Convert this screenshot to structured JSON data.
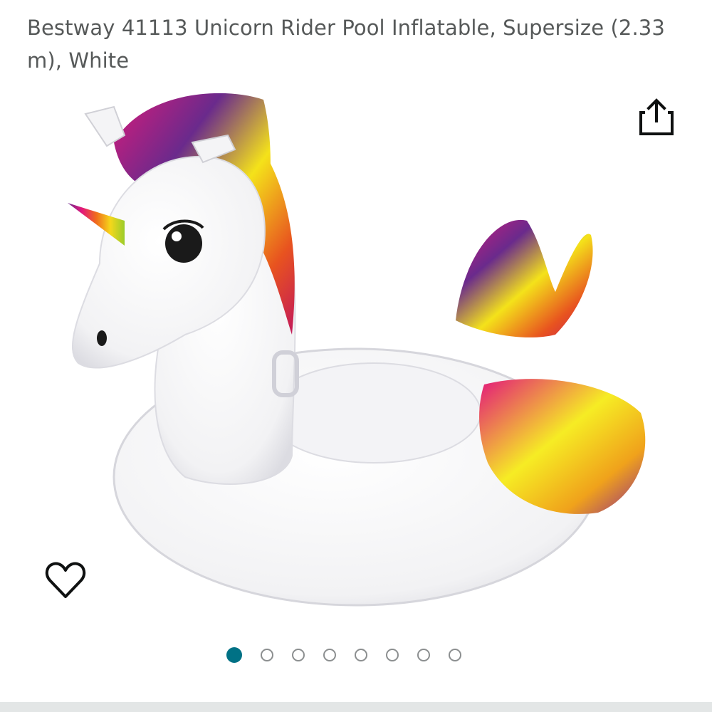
{
  "product": {
    "title": "Bestway 41113 Unicorn Rider Pool Inflatable, Supersize (2.33 m), White"
  },
  "actions": {
    "share_icon": "share-icon",
    "wishlist_icon": "heart-outline-icon"
  },
  "carousel": {
    "total_images": 8,
    "current_index": 0
  },
  "colors": {
    "title_text": "#565959",
    "active_dot": "#007185",
    "inactive_dot_border": "#8c8f90",
    "icon": "#0f1111",
    "divider": "#e3e6e6"
  }
}
